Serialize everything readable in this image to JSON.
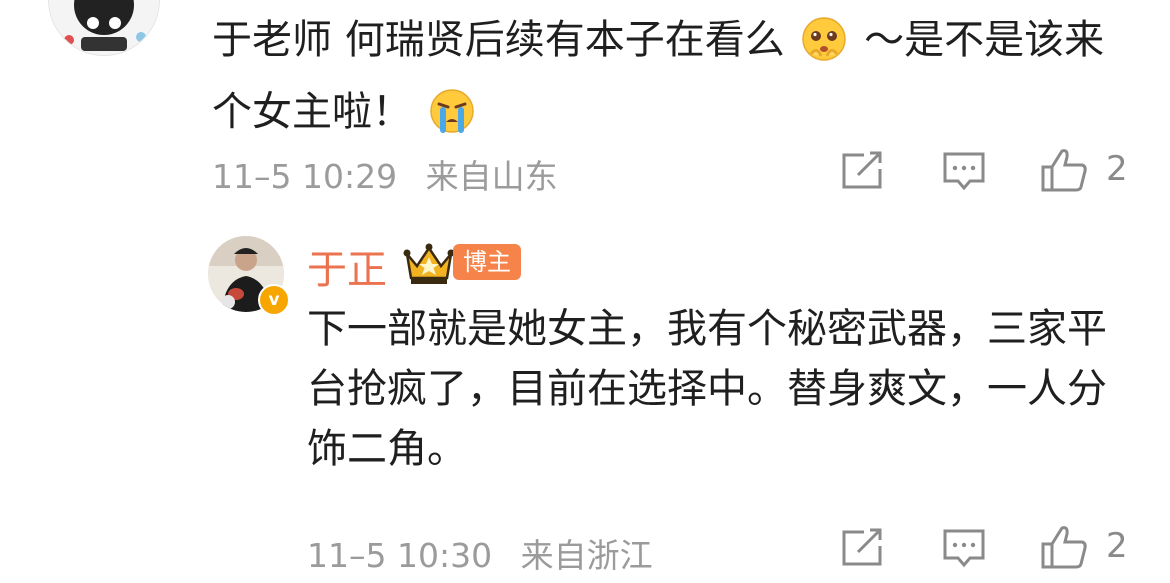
{
  "comment": {
    "text_part1": "于老师 何瑞贤后续有本子在看么",
    "text_part2": "～是不是该来个女主啦！",
    "emoji_1": "pleading-face-emoji",
    "emoji_2": "crying-face-emoji",
    "time": "11–5 10:29",
    "location": "来自山东",
    "like_count": "2"
  },
  "reply": {
    "author": "于正",
    "badge": "博主",
    "text": "下一部就是她女主，我有个秘密武器，三家平台抢疯了，目前在选择中。替身爽文，一人分饰二角。",
    "time": "11–5 10:30",
    "location": "来自浙江",
    "like_count": "2",
    "verified_mark": "v"
  },
  "icons": {
    "share": "share-icon",
    "comment": "comment-icon",
    "like": "like-icon",
    "crown": "crown-icon"
  },
  "colors": {
    "author_name": "#eb7350",
    "badge_bg": "#f6834a",
    "meta_text": "#9b9b9b",
    "verified_badge": "#f7a600"
  }
}
